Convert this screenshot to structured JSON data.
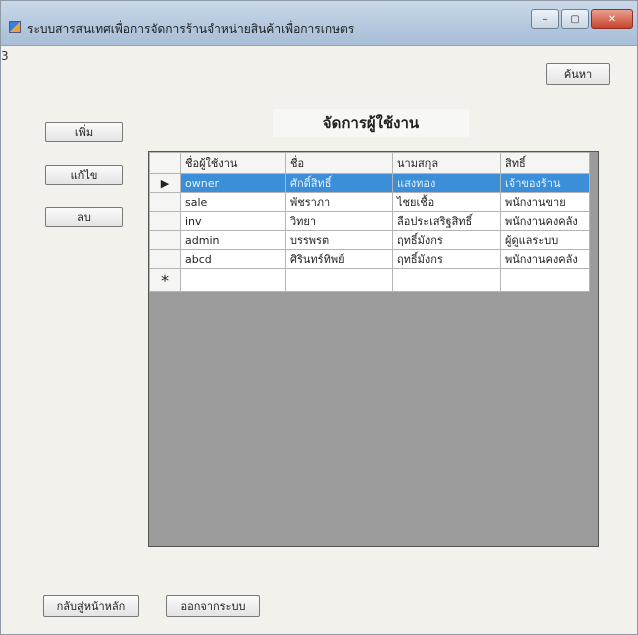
{
  "window": {
    "title": "ระบบสารสนเทศเพื่อการจัดการร้านจำหน่ายสินค้าเพื่อการเกษตร",
    "minimize": "–",
    "maximize": "▢",
    "close": "✕",
    "side_mark": "3"
  },
  "toolbar": {
    "search_label": "ค้นหา",
    "add_label": "เพิ่ม",
    "edit_label": "แก้ไข",
    "delete_label": "ลบ"
  },
  "page": {
    "heading": "จัดการผู้ใช้งาน"
  },
  "table": {
    "columns": [
      "ชื่อผู้ใช้งาน",
      "ชื่อ",
      "นามสกุล",
      "สิทธิ์"
    ],
    "rows": [
      [
        "owner",
        "ศักดิ์สิทธิ์",
        "แสงทอง",
        "เจ้าของร้าน"
      ],
      [
        "sale",
        "พัชราภา",
        "ไชยเชื้อ",
        "พนักงานขาย"
      ],
      [
        "inv",
        "วิทยา",
        "ลือประเสริฐสิทธิ์",
        "พนักงานคงคลัง"
      ],
      [
        "admin",
        "บรรพรต",
        "ฤทธิ์มังกร",
        "ผู้ดูแลระบบ"
      ],
      [
        "abcd",
        "ศิรินทร์ทิพย์",
        "ฤทธิ์มังกร",
        "พนักงานคงคลัง"
      ]
    ],
    "selected_row": 0,
    "current_row_marker": "▶",
    "new_row_marker": "*"
  },
  "footer": {
    "back_label": "กลับสู่หน้าหลัก",
    "exit_label": "ออกจากระบบ"
  },
  "colors": {
    "selection": "#3a8fd8",
    "grid_background": "#9b9b9b"
  }
}
